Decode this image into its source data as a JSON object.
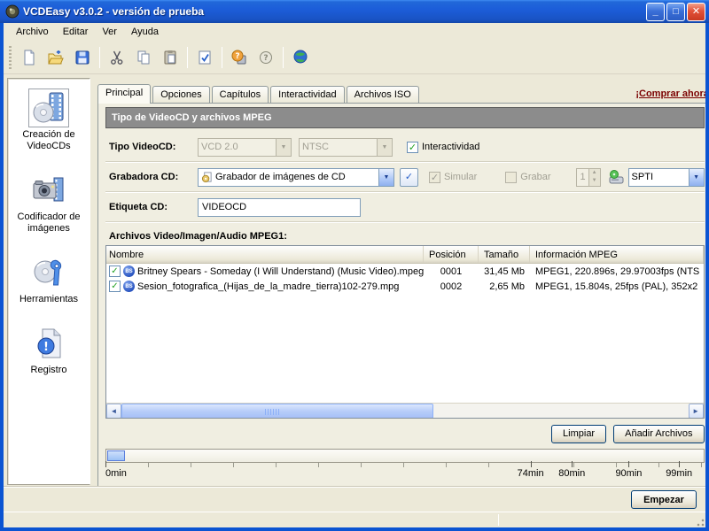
{
  "window": {
    "title": "VCDEasy v3.0.2 - versión de prueba"
  },
  "menu": {
    "items": [
      {
        "label": "Archivo"
      },
      {
        "label": "Editar"
      },
      {
        "label": "Ver"
      },
      {
        "label": "Ayuda"
      }
    ]
  },
  "toolbar": {
    "icons": [
      "new-document-icon",
      "open-folder-icon",
      "save-icon",
      "cut-icon",
      "copy-icon",
      "paste-icon",
      "check-settings-icon",
      "help-contents-icon",
      "help-about-icon",
      "web-icon"
    ]
  },
  "sidebar": {
    "items": [
      {
        "label": "Creación de VideoCDs",
        "icon": "videocd-creation-icon",
        "selected": "true"
      },
      {
        "label": "Codificador de imágenes",
        "icon": "image-encoder-icon"
      },
      {
        "label": "Herramientas",
        "icon": "tools-icon"
      },
      {
        "label": "Registro",
        "icon": "log-icon"
      }
    ]
  },
  "header": {
    "tabs": [
      {
        "label": "Principal"
      },
      {
        "label": "Opciones"
      },
      {
        "label": "Capítulos"
      },
      {
        "label": "Interactividad"
      },
      {
        "label": "Archivos ISO"
      }
    ],
    "active_tab": "Principal",
    "buy_link": "¡Comprar ahora!"
  },
  "panel": {
    "section_title": "Tipo de VideoCD y archivos MPEG",
    "tipo_videocd": {
      "label": "Tipo VideoCD:",
      "value": "VCD 2.0"
    },
    "formato": {
      "value": "NTSC"
    },
    "interactividad": {
      "label": "Interactividad",
      "checked": "yes"
    },
    "grabadora": {
      "label": "Grabadora CD:",
      "value": "Grabador de imágenes de CD"
    },
    "simular": {
      "label": "Simular",
      "checked": "yes"
    },
    "grabar": {
      "label": "Grabar",
      "checked": "no"
    },
    "copias": {
      "value": "1"
    },
    "interfaz": {
      "value": "SPTI"
    },
    "etiqueta": {
      "label": "Etiqueta CD:",
      "value": "VIDEOCD"
    },
    "files_title": "Archivos Video/Imagen/Audio MPEG1:",
    "file_list": {
      "icon_label": "BS",
      "columns": [
        {
          "label": "Nombre"
        },
        {
          "label": "Posición"
        },
        {
          "label": "Tamaño"
        },
        {
          "label": "Información MPEG"
        }
      ],
      "rows": [
        {
          "checked": "yes",
          "icon": "bsplayer-file-icon",
          "name": "Britney Spears - Someday (I Will Understand) (Music Video).mpeg",
          "position": "0001",
          "size": "31,45 Mb",
          "info": "MPEG1, 220.896s, 29.97003fps (NTS"
        },
        {
          "checked": "yes",
          "icon": "bsplayer-file-icon",
          "name": "Sesion_fotografica_(Hijas_de_la_madre_tierra)102-279.mpg",
          "position": "0002",
          "size": "2,65 Mb",
          "info": "MPEG1, 15.804s, 25fps (PAL), 352x2"
        }
      ]
    },
    "buttons": {
      "limpiar": "Limpiar",
      "anadir": "Añadir Archivos"
    }
  },
  "timeline": {
    "labels": [
      {
        "text": "0min"
      },
      {
        "text": "74min"
      },
      {
        "text": "80min"
      },
      {
        "text": "90min"
      },
      {
        "text": "99min"
      }
    ],
    "fill_percent": "3"
  },
  "footer": {
    "empezar": "Empezar"
  },
  "colors": {
    "titlebar_blue": "#1c5dd9",
    "frame_blue": "#0b54d2",
    "face": "#ece9d8",
    "section_gray": "#8c8c8c",
    "link_maroon": "#7b0000",
    "check_green": "#21a121",
    "scroll_thumb": "#b7cdf9"
  }
}
